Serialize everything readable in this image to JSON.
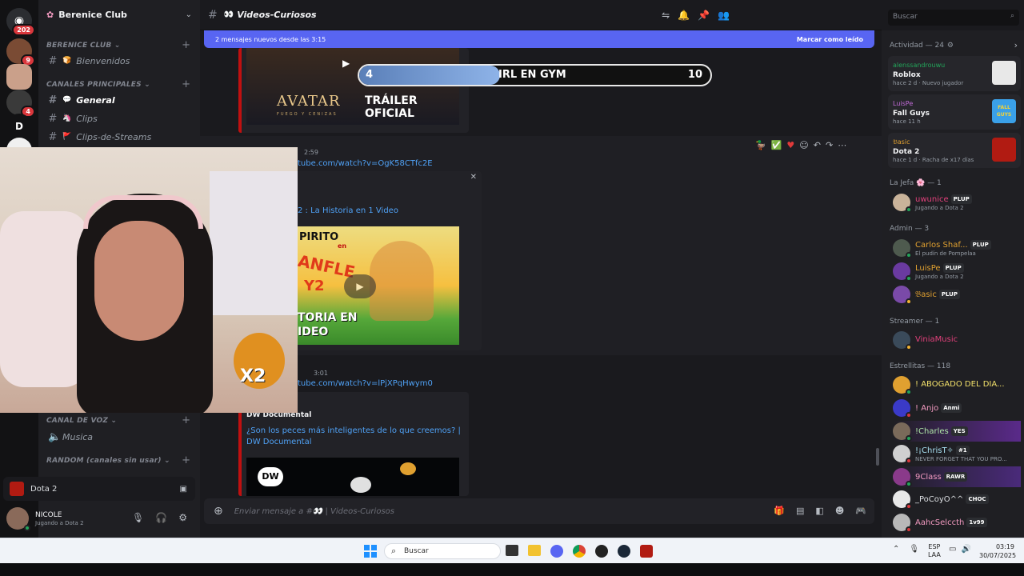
{
  "guilds": {
    "home_badge": "202",
    "items": [
      {
        "badge": "9",
        "color": "#7a4b34"
      },
      {
        "badge": "",
        "color": "#caa08a"
      },
      {
        "badge": "4",
        "color": "#3a3a3a"
      },
      {
        "letter": "D",
        "badge": "",
        "color": "#121214"
      },
      {
        "badge": "",
        "color": "#f0f0f0"
      }
    ]
  },
  "server": {
    "name": "Berenice Club",
    "categories": [
      {
        "label": "BERENICE CLUB ⌄"
      },
      {
        "label": "CANALES PRINCIPALES ⌄"
      },
      {
        "label": "CANAL DE VOZ ⌄"
      },
      {
        "label": "RANDOM (canales sin usar) ⌄"
      }
    ],
    "channels": [
      {
        "emoji": "🍞",
        "name": "Bienvenidos"
      },
      {
        "emoji": "💬",
        "name": "General"
      },
      {
        "emoji": "🦄",
        "name": "Clips"
      },
      {
        "emoji": "🚩",
        "name": "Clips-de-Streams"
      }
    ],
    "voice_channel": {
      "name": "Musica"
    }
  },
  "activity_panel": {
    "game": "Dota 2"
  },
  "user": {
    "name": "NICOLE",
    "status": "Jugando a Dota 2"
  },
  "chat": {
    "channel_title": "Videos-Curiosos",
    "channel_emoji": "👀",
    "banner_text": "2 mensajes nuevos desde las 3:15",
    "banner_action": "Marcar como leído",
    "overlay": {
      "left_num": "4",
      "title": "IRL EN GYM",
      "right_num": "10",
      "fill": 0.4
    },
    "embed1": {
      "brand": "AVATAR",
      "brand_sub": "FUEGO Y CENIZAS",
      "caption_l1": "TRÁILER",
      "caption_l2": "OFICIAL"
    },
    "msg2": {
      "time": "2:59",
      "link": "tube.com/watch?v=OgK58CTfc2E",
      "embed_title": "2 : La Historia en 1 Video",
      "thumb_text_1": "PIRITO",
      "thumb_text_2": "en",
      "thumb_text_3": "ANFLE",
      "thumb_text_4": "Y2",
      "thumb_text_5": "TORIA EN",
      "thumb_text_6": "IDEO"
    },
    "msg3": {
      "time": "3:01",
      "link": "tube.com/watch?v=lPjXPqHwym0",
      "provider": "DW Documental",
      "embed_title": "¿Son los peces más inteligentes de lo que creemos? | DW Documental",
      "thumb_logo": "DW"
    },
    "input_placeholder": "Enviar mensaje a #👀 | Videos-Curiosos",
    "search_placeholder": "Buscar"
  },
  "webcam": {
    "overlay_label": "X2"
  },
  "members": {
    "activity_header": "Actividad — 24",
    "activities": [
      {
        "user": "alenssandrouwu",
        "game": "Roblox",
        "meta1": "hace 2 d",
        "meta2": "Nuevo jugador",
        "user_color": "#23a55a",
        "thumb": "#e8e8e8"
      },
      {
        "user": "LuisPe",
        "game": "Fall Guys",
        "meta1": "hace 11 h",
        "meta2": "",
        "user_color": "#c26bd8",
        "thumb": "#3aa0e8",
        "thumb_text": "FALL GUYS"
      },
      {
        "user": "𝔅asic",
        "game": "Dota 2",
        "meta1": "hace 1 d",
        "meta2": "Racha de x17 días",
        "user_color": "#e0a030",
        "thumb": "#b11b12"
      }
    ],
    "groups": [
      {
        "label": "La Jefa 🌸 — 1",
        "members": [
          {
            "name": "uwunice",
            "tag": "PLUP",
            "sub": "Jugando a Dota 2",
            "color": "#e0407a"
          }
        ]
      },
      {
        "label": "Admin — 3",
        "members": [
          {
            "name": "Carlos Shaf...",
            "tag": "PLUP",
            "sub": "El pudín de Pompelaa",
            "color": "#e0a030"
          },
          {
            "name": "LuisPe",
            "tag": "PLUP",
            "sub": "Jugando a Dota 2",
            "color": "#e0a030"
          },
          {
            "name": "𝔅asic",
            "tag": "PLUP",
            "sub": "",
            "color": "#e0a030"
          }
        ]
      },
      {
        "label": "Streamer — 1",
        "members": [
          {
            "name": "ViniaMusic",
            "tag": "",
            "sub": "",
            "color": "#e0407a"
          }
        ]
      },
      {
        "label": "Estrellitas — 118",
        "members": [
          {
            "name": "! ABOGADO DEL DIA...",
            "tag": "",
            "sub": "",
            "color": "#f2e06a"
          },
          {
            "name": "! Anjo",
            "tag": "Anmi",
            "sub": "",
            "color": "#f29ac0"
          },
          {
            "name": "!Charles",
            "tag": "YES",
            "sub": "",
            "color": "#b0e8a8"
          },
          {
            "name": "!¡ChrisT✧",
            "tag": "#1",
            "sub": "NEVER FORGET THAT YOU PRO...",
            "color": "#a8e0f0"
          },
          {
            "name": "9Class",
            "tag": "RAWR",
            "sub": "",
            "color": "#f29ac0"
          },
          {
            "name": "_PoCoyO^^",
            "tag": "CHOC",
            "sub": "",
            "color": "#dbdee1"
          },
          {
            "name": "AahcSelccth",
            "tag": "1v99",
            "sub": "",
            "color": "#f29ac0"
          }
        ]
      }
    ]
  },
  "taskbar": {
    "search_label": "Buscar",
    "lang1": "ESP",
    "lang2": "LAA",
    "time": "03:19",
    "date": "30/07/2025"
  },
  "colors": {
    "accent": "#5865f2",
    "online": "#23a55a",
    "embed_bar": "#c01010",
    "link": "#4fa1f5"
  }
}
